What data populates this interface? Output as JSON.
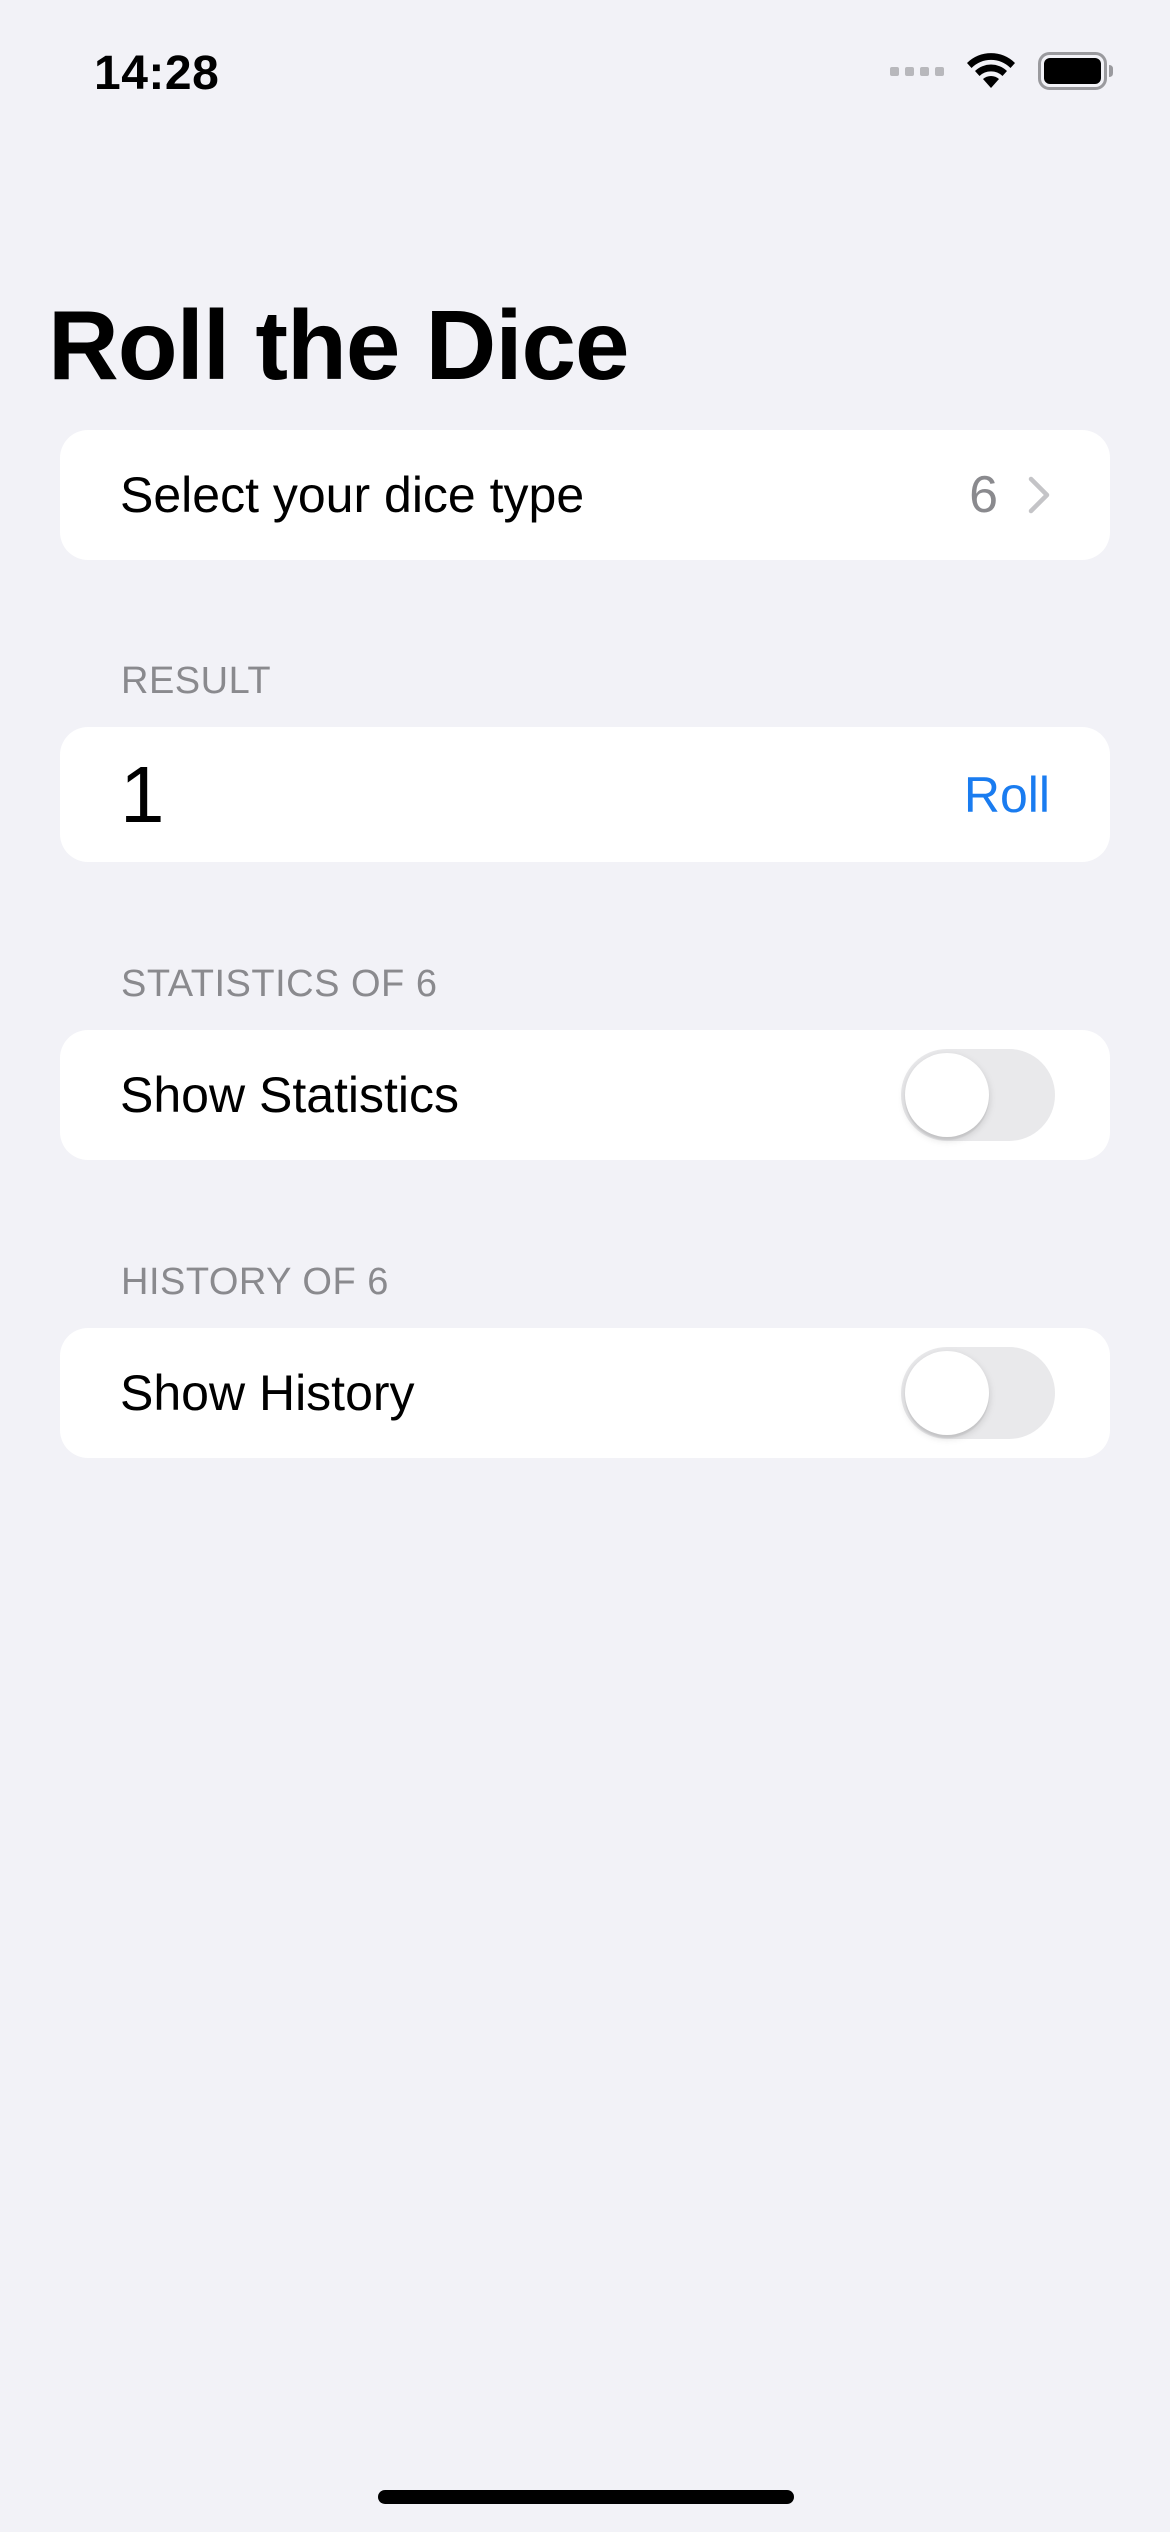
{
  "status_bar": {
    "time": "14:28",
    "icons": [
      "cellular-signal-icon",
      "wifi-icon",
      "battery-icon"
    ]
  },
  "page": {
    "title": "Roll the Dice"
  },
  "dice_type": {
    "label": "Select your dice type",
    "value": "6"
  },
  "result": {
    "header": "RESULT",
    "value": "1",
    "action_label": "Roll"
  },
  "statistics": {
    "header": "STATISTICS OF 6",
    "label": "Show Statistics",
    "enabled": false
  },
  "history": {
    "header": "HISTORY OF 6",
    "label": "Show History",
    "enabled": false
  },
  "colors": {
    "background": "#f2f2f7",
    "card": "#ffffff",
    "accent": "#1a7cf0",
    "secondary_text": "#8a8a8e",
    "toggle_off": "#e9e9eb"
  }
}
